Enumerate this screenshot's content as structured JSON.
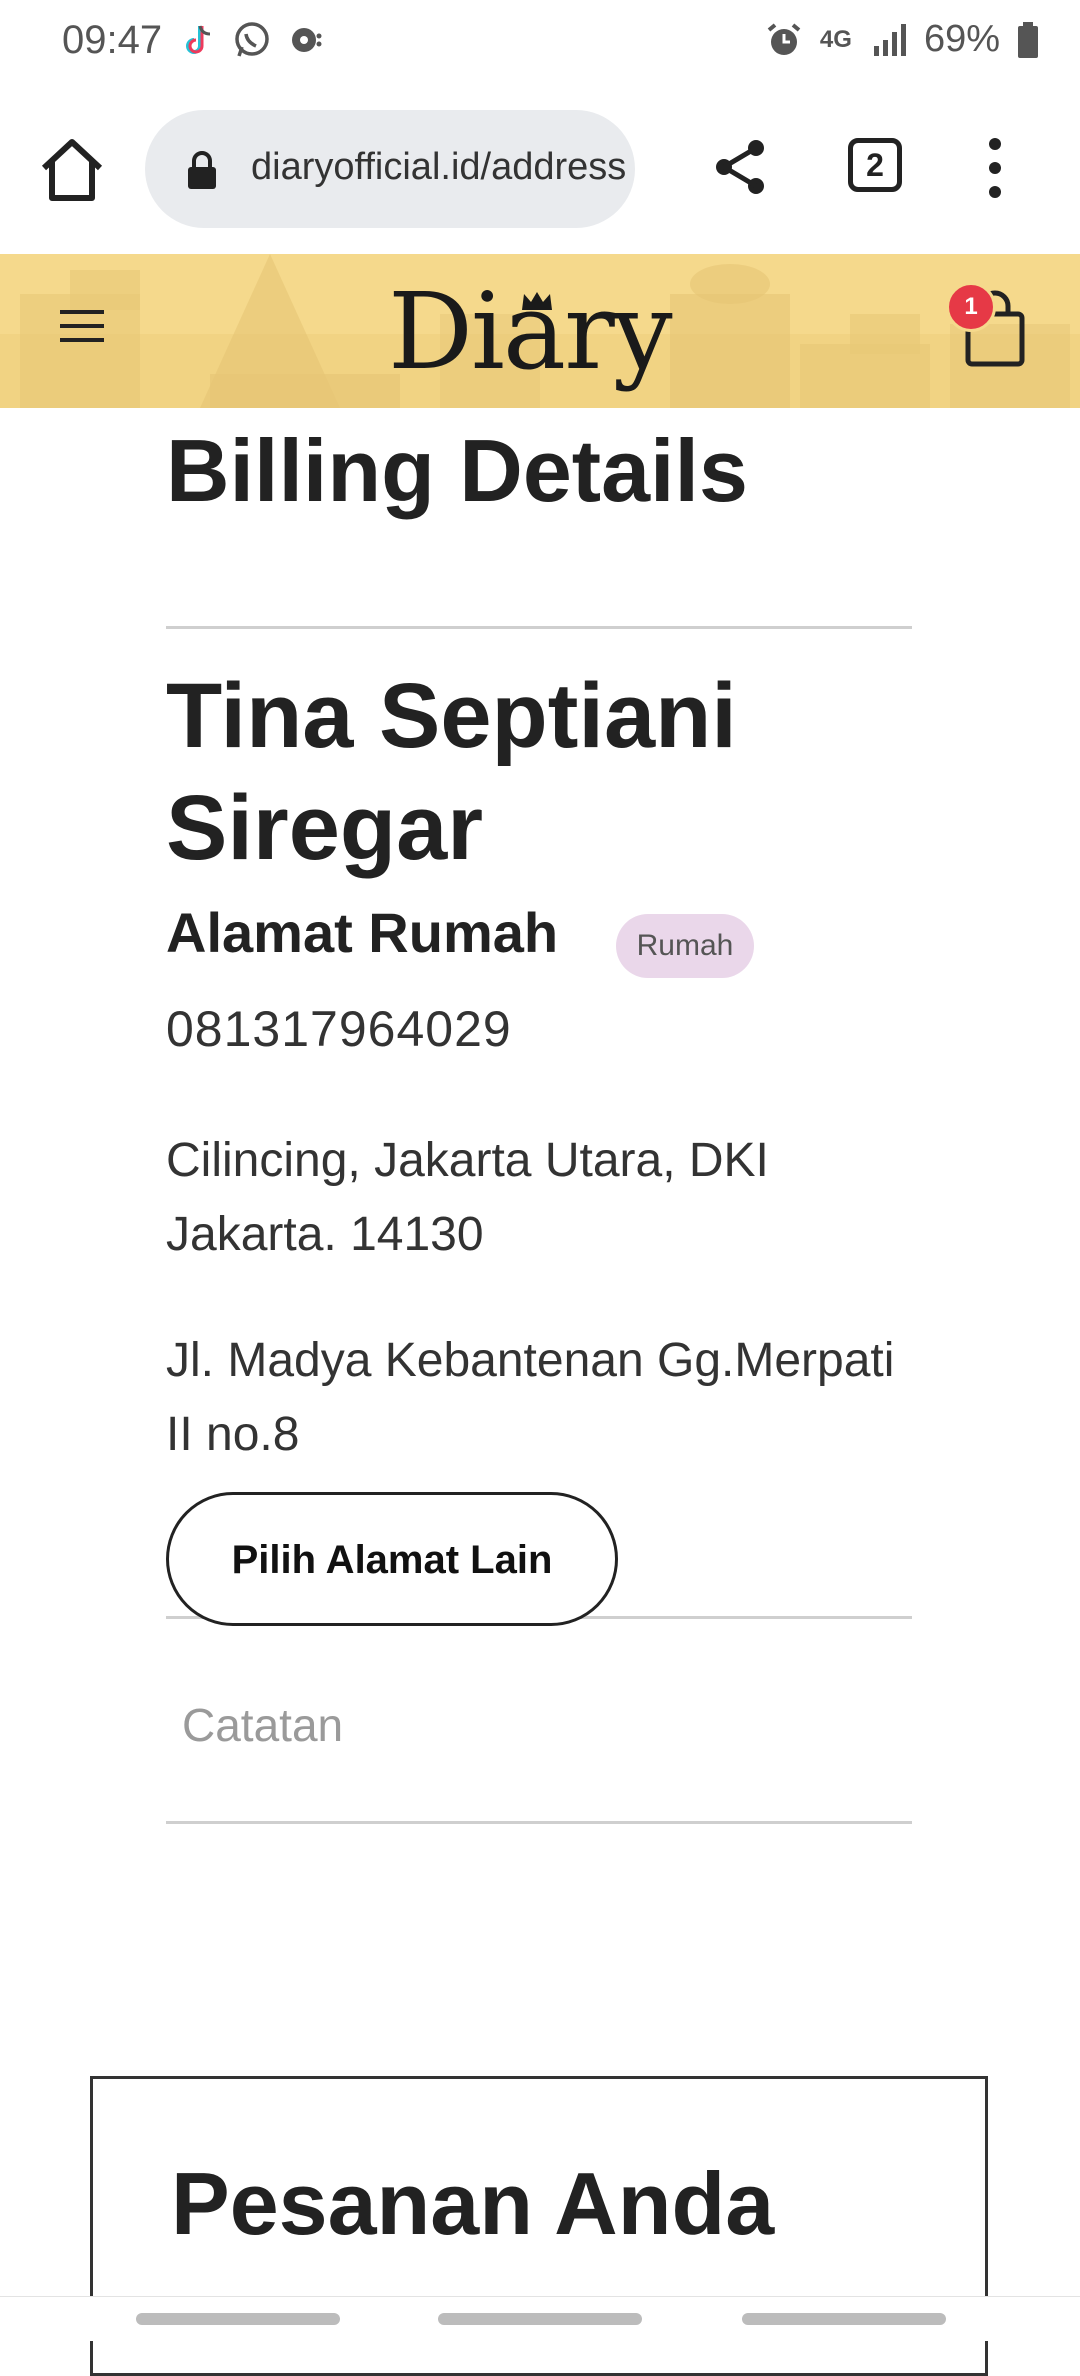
{
  "status_bar": {
    "time": "09:47",
    "network": "4G",
    "battery": "69%",
    "icons": [
      "tiktok-icon",
      "whatsapp-icon",
      "chat-bubble-icon",
      "alarm-icon",
      "network-4g-icon",
      "signal-icon",
      "battery-icon"
    ]
  },
  "browser": {
    "url": "diaryofficial.id/address",
    "tab_count": "2",
    "icons": [
      "home-icon",
      "lock-icon",
      "share-icon",
      "tabs-icon",
      "more-vertical-icon"
    ]
  },
  "header": {
    "logo": "Diary",
    "cart_count": "1",
    "colors": {
      "background": "#f5d98c",
      "badge": "#e63946"
    },
    "icons": [
      "hamburger-icon",
      "crown-icon",
      "shopping-bag-icon"
    ]
  },
  "billing": {
    "title": "Billing Details",
    "name": "Tina Septiani Siregar",
    "address_label": "Alamat Rumah",
    "address_tag": "Rumah",
    "phone": "081317964029",
    "region": "Cilincing, Jakarta Utara, DKI Jakarta. 14130",
    "street": "Jl. Madya Kebantenan Gg.Merpati II no.8",
    "alt_address_button": "Pilih Alamat Lain",
    "notes_placeholder": "Catatan"
  },
  "order": {
    "title": "Pesanan Anda"
  }
}
